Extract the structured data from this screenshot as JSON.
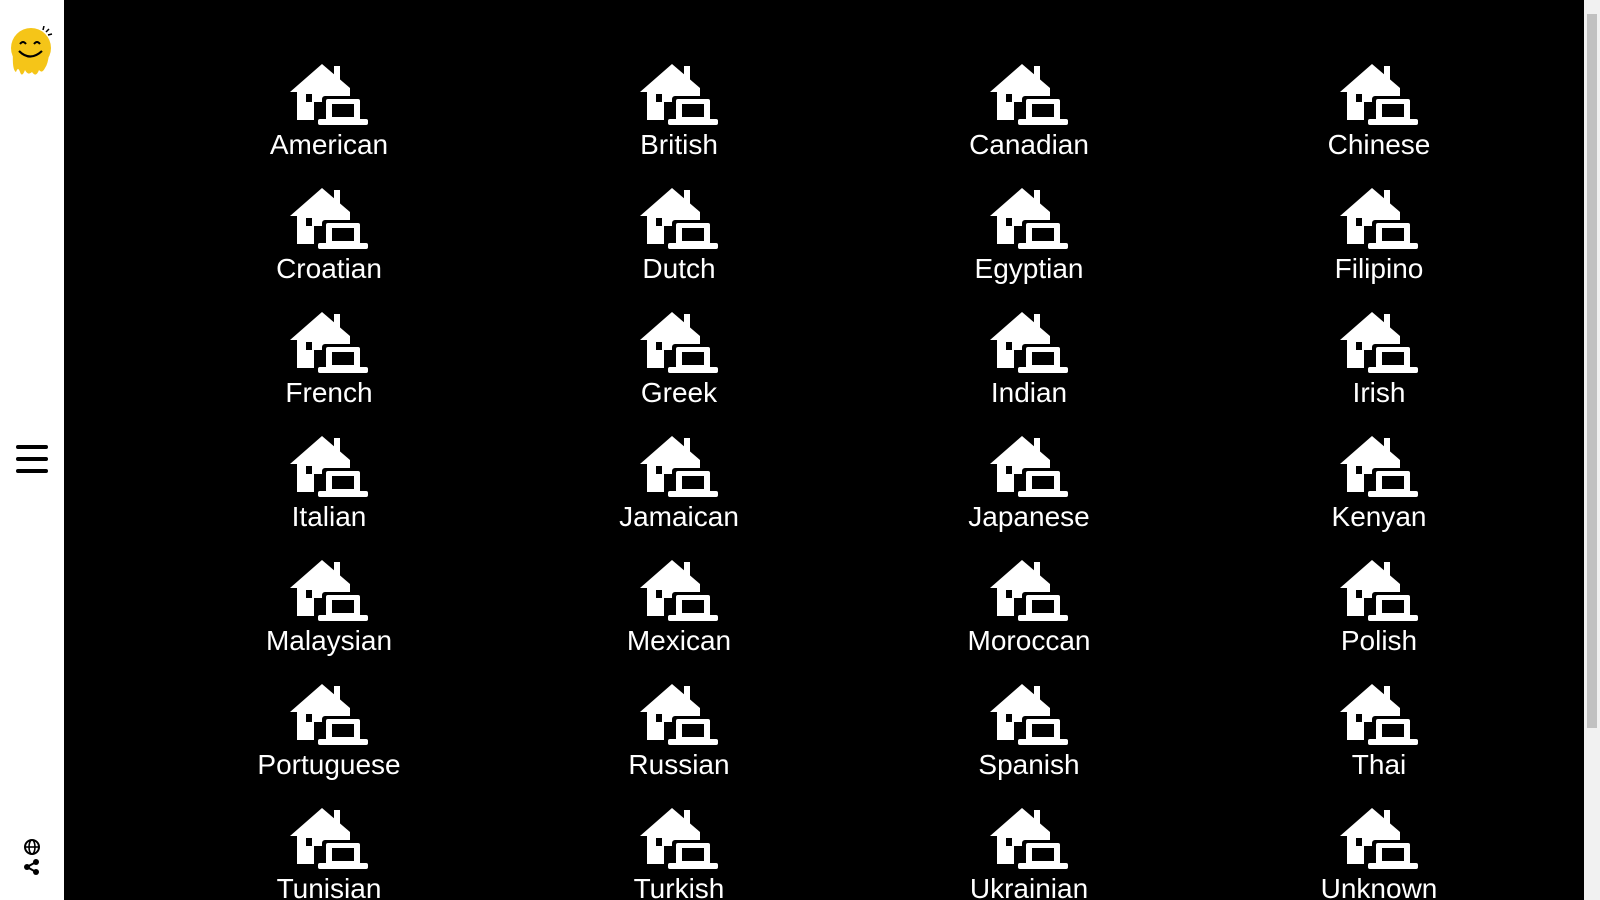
{
  "sidebar": {
    "logo_icon": "smiley-drip-logo",
    "menu_icon": "hamburger-icon",
    "language_icon": "globe-icon",
    "share_icon": "share-icon",
    "accent_color": "#f5c518"
  },
  "cuisines": {
    "icon": "home-laptop-icon",
    "items": [
      {
        "label": "American"
      },
      {
        "label": "British"
      },
      {
        "label": "Canadian"
      },
      {
        "label": "Chinese"
      },
      {
        "label": "Croatian"
      },
      {
        "label": "Dutch"
      },
      {
        "label": "Egyptian"
      },
      {
        "label": "Filipino"
      },
      {
        "label": "French"
      },
      {
        "label": "Greek"
      },
      {
        "label": "Indian"
      },
      {
        "label": "Irish"
      },
      {
        "label": "Italian"
      },
      {
        "label": "Jamaican"
      },
      {
        "label": "Japanese"
      },
      {
        "label": "Kenyan"
      },
      {
        "label": "Malaysian"
      },
      {
        "label": "Mexican"
      },
      {
        "label": "Moroccan"
      },
      {
        "label": "Polish"
      },
      {
        "label": "Portuguese"
      },
      {
        "label": "Russian"
      },
      {
        "label": "Spanish"
      },
      {
        "label": "Thai"
      },
      {
        "label": "Tunisian"
      },
      {
        "label": "Turkish"
      },
      {
        "label": "Ukrainian"
      },
      {
        "label": "Unknown"
      }
    ]
  },
  "colors": {
    "background": "#000000",
    "sidebar": "#ffffff",
    "text": "#ffffff"
  }
}
